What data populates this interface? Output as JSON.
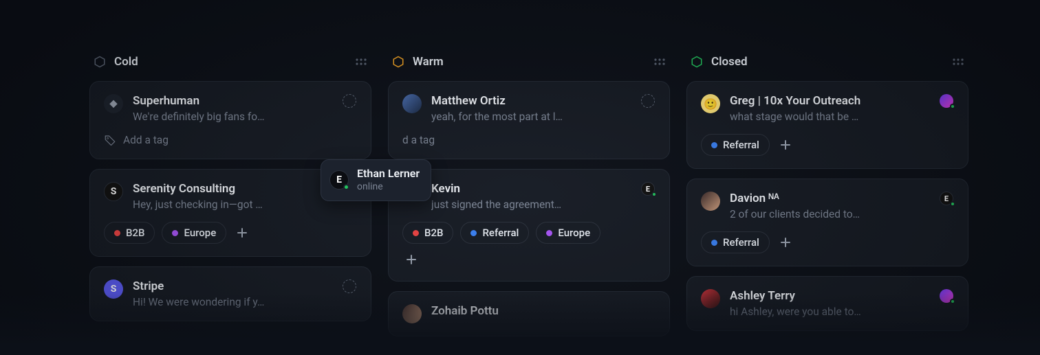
{
  "hover": {
    "name": "Ethan Lerner",
    "status": "online",
    "initial": "E"
  },
  "addTagLabel": "Add a tag",
  "tagColors": {
    "B2B": "#ef4444",
    "Europe": "#a855f7",
    "Referral": "#3b82f6"
  },
  "columns": [
    {
      "title": "Cold",
      "hexColor": "#5b6474",
      "cards": [
        {
          "name": "Superhuman",
          "preview": "We're definitely big fans fo…",
          "avatar": "icon",
          "glyph": "◆",
          "assignee": "dashed",
          "tags": [],
          "showAddTag": true
        },
        {
          "name": "Serenity Consulting",
          "preview": "Hey, just checking in—got …",
          "avatar": "letter",
          "initial": "S",
          "assignee": "e-online",
          "tags": [
            "B2B",
            "Europe"
          ],
          "showAddBtn": true
        },
        {
          "name": "Stripe",
          "preview": "Hi! We were wondering if y…",
          "avatar": "letter-s2",
          "initial": "S",
          "assignee": "dashed",
          "tags": []
        }
      ]
    },
    {
      "title": "Warm",
      "hexColor": "#f5a524",
      "cards": [
        {
          "name": "Matthew Ortiz",
          "preview": "yeah, for the most part at l…",
          "avatar": "photo1",
          "assignee": "dashed",
          "tags": [],
          "showAddTag": true,
          "addTagTruncated": "d a tag"
        },
        {
          "name": "Kevin",
          "preview": "just signed the agreement…",
          "avatar": "photo2",
          "assignee": "e-online",
          "tags": [
            "B2B",
            "Referral",
            "Europe"
          ],
          "showAddBtn": true,
          "addBtnNewline": true
        },
        {
          "name": "Zohaib Pottu",
          "preview": "",
          "avatar": "photo3",
          "assignee": "none",
          "tags": []
        }
      ]
    },
    {
      "title": "Closed",
      "hexColor": "#22c55e",
      "cards": [
        {
          "name": "Greg | 10x Your Outreach",
          "preview": "what stage would that be …",
          "avatar": "emoji",
          "glyph": "🙂",
          "assignee": "grad-online",
          "tags": [
            "Referral"
          ],
          "showAddBtn": true
        },
        {
          "name": "Davion ᴺᴬ",
          "preview": "2 of our clients decided to…",
          "avatar": "photo3",
          "assignee": "e-online",
          "tags": [
            "Referral"
          ],
          "showAddBtn": true
        },
        {
          "name": "Ashley Terry",
          "preview": "hi Ashley, were you able to…",
          "avatar": "photo4",
          "assignee": "grad-online",
          "tags": []
        }
      ]
    }
  ]
}
